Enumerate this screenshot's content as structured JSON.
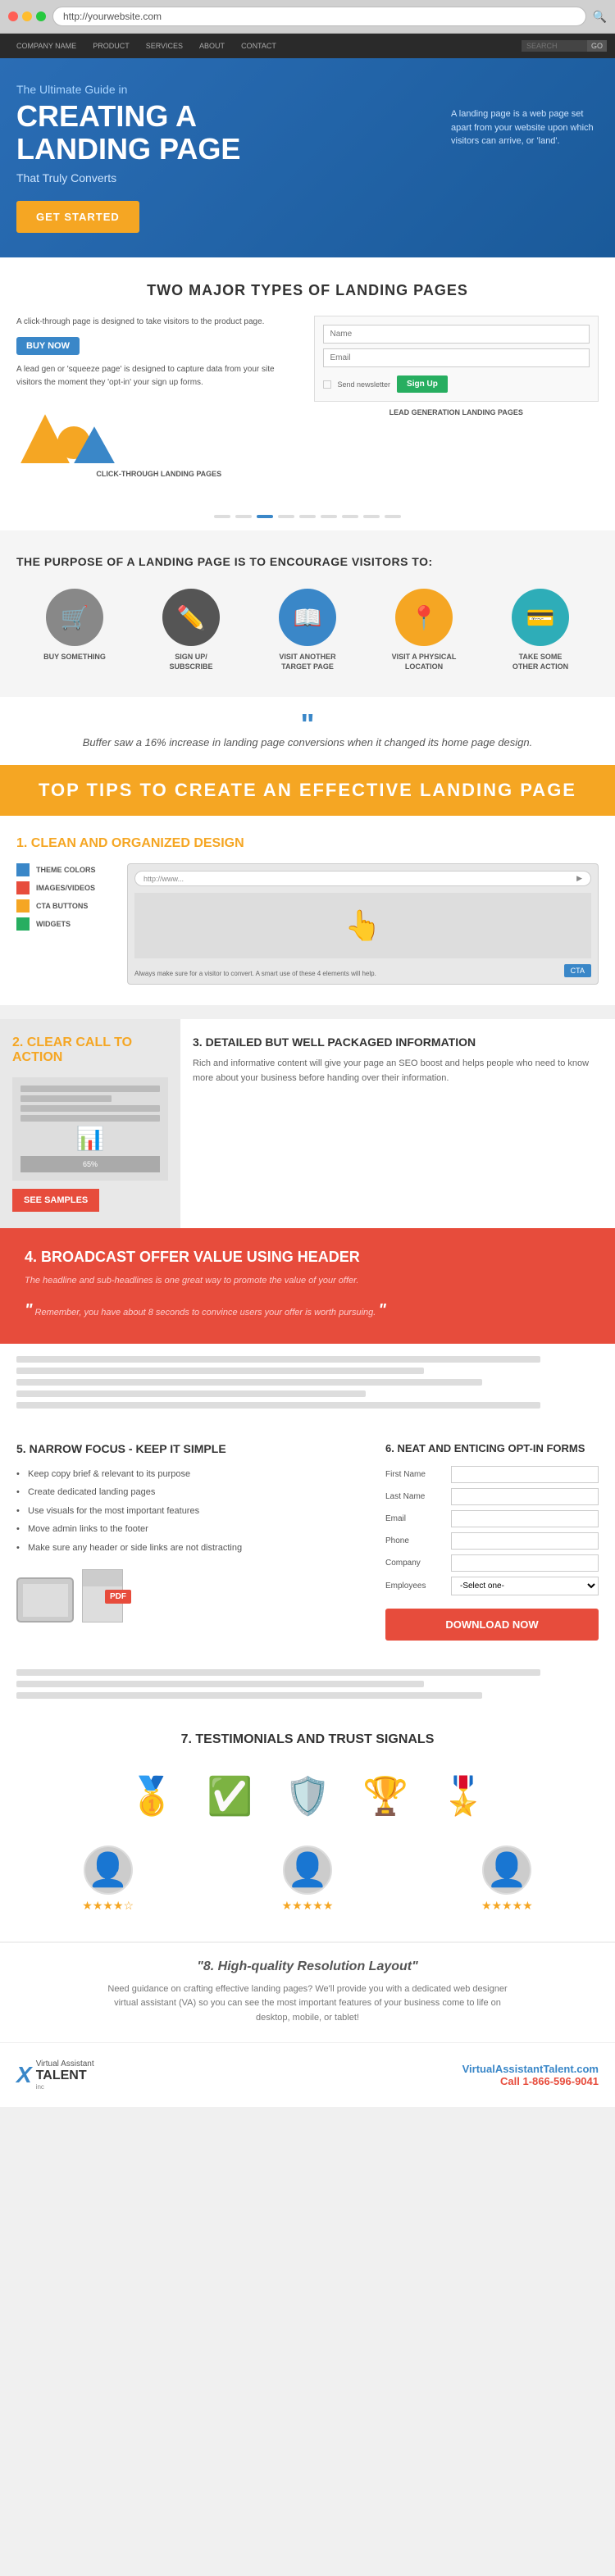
{
  "browser": {
    "url": "http://yourwebsite.com",
    "dots": [
      "red",
      "yellow",
      "green"
    ]
  },
  "nav": {
    "items": [
      "COMPANY NAME",
      "PRODUCT",
      "SERVICES",
      "ABOUT",
      "CONTACT"
    ],
    "search_placeholder": "SEARCH"
  },
  "hero": {
    "subtitle": "The Ultimate Guide in",
    "title_line1": "CREATING A",
    "title_line2": "LANDING PAGE",
    "tagline": "That Truly Converts",
    "cta_label": "GET STARTED",
    "description": "A landing page is a web page set apart from your website upon which visitors can arrive, or 'land'."
  },
  "two_types": {
    "section_title": "TWO MAJOR TYPES OF LANDING PAGES",
    "clickthrough": {
      "text1": "A click-through page is designed to take visitors to the product page.",
      "text2": "A lead gen or 'squeeze page' is designed to capture data from your site visitors the moment they 'opt-in' your sign up forms.",
      "btn_label": "BUY NOW",
      "label": "CLICK-THROUGH LANDING PAGES"
    },
    "leadgen": {
      "name_placeholder": "Name",
      "email_placeholder": "Email",
      "newsletter_label": "Send newsletter",
      "signup_label": "Sign Up",
      "label": "LEAD GENERATION LANDING PAGES"
    }
  },
  "purpose": {
    "title": "THE PURPOSE OF A LANDING PAGE IS TO ENCOURAGE VISITORS TO:",
    "icons": [
      {
        "label": "BUY SOMETHING",
        "emoji": "🛒",
        "color": "gray"
      },
      {
        "label": "SIGN UP/ SUBSCRIBE",
        "emoji": "✏️",
        "color": "dark"
      },
      {
        "label": "VISIT ANOTHER TARGET PAGE",
        "emoji": "📖",
        "color": "blue"
      },
      {
        "label": "VISIT A PHYSICAL LOCATION",
        "emoji": "📍",
        "color": "orange"
      },
      {
        "label": "TAKE SOME OTHER ACTION",
        "emoji": "💳",
        "color": "teal"
      }
    ]
  },
  "quote": {
    "text": "Buffer saw a 16% increase in landing page conversions when it changed its home page design."
  },
  "orange_banner": {
    "title": "TOP TIPS TO CREATE AN EFFECTIVE LANDING PAGE"
  },
  "tip1": {
    "number": "1.",
    "title": "CLEAN AND ORGANIZED DESIGN",
    "swatches": [
      {
        "label": "THEME COLORS",
        "color": "blue"
      },
      {
        "label": "IMAGES/VIDEOS",
        "color": "red"
      },
      {
        "label": "CTA BUTTONS",
        "color": "orange"
      },
      {
        "label": "WIDGETS",
        "color": "green"
      }
    ],
    "preview_url": "http://www...",
    "preview_footer": "Always make sure for a visitor to convert. A smart use of these 4 elements will help.",
    "cta_btn": "CTA"
  },
  "tip2": {
    "number": "2.",
    "title": "CLEAR CALL TO ACTION",
    "btn_label": "SEE SAMPLES"
  },
  "tip3": {
    "number": "3.",
    "title": "DETAILED BUT WELL PACKAGED INFORMATION",
    "text": "Rich and informative content will give your page an SEO boost and helps people who need to know more about your business before handing over their information."
  },
  "tip4": {
    "number": "4.",
    "title": "BROADCAST OFFER VALUE USING HEADER",
    "subtitle": "The headline and sub-headlines is one great way to promote the value of your offer.",
    "quote": "Remember, you have about 8 seconds to convince users your offer is worth pursuing."
  },
  "tip5": {
    "number": "5.",
    "title": "NARROW FOCUS - KEEP IT SIMPLE",
    "bullets": [
      "Keep copy brief & relevant to its purpose",
      "Create dedicated landing pages",
      "Use visuals for the most important features",
      "Move admin links to the footer",
      "Make sure any header or side links are not distracting"
    ]
  },
  "tip6": {
    "number": "6.",
    "title": "NEAT AND ENTICING OPT-IN FORMS",
    "fields": [
      {
        "label": "First Name",
        "type": "text"
      },
      {
        "label": "Last Name",
        "type": "text"
      },
      {
        "label": "Email",
        "type": "email"
      },
      {
        "label": "Phone",
        "type": "tel"
      },
      {
        "label": "Company",
        "type": "text"
      },
      {
        "label": "Employees",
        "type": "select",
        "placeholder": "-Select one-"
      }
    ],
    "download_btn": "DOWNLOAD NOW"
  },
  "tip7": {
    "number": "7.",
    "title": "TESTIMONIALS AND TRUST SIGNALS",
    "awards": [
      "🥇",
      "✅",
      "🛡️",
      "🏆",
      "🎖️"
    ],
    "testimonials": [
      {
        "stars": 4
      },
      {
        "stars": 5
      },
      {
        "stars": 5
      }
    ]
  },
  "tip8": {
    "number": "\"8.",
    "title": "High-quality Resolution Layout\"",
    "text": "Need guidance on crafting effective landing pages? We'll provide you with a dedicated web designer virtual assistant (VA) so you can see the most important features of your business come to life on desktop, mobile, or tablet!"
  },
  "footer": {
    "logo_x": "X",
    "logo_name": "irtual\nAssistant\nTALENT",
    "website": "VirtualAssistantTalent.com",
    "phone": "Call 1-866-596-9041"
  }
}
